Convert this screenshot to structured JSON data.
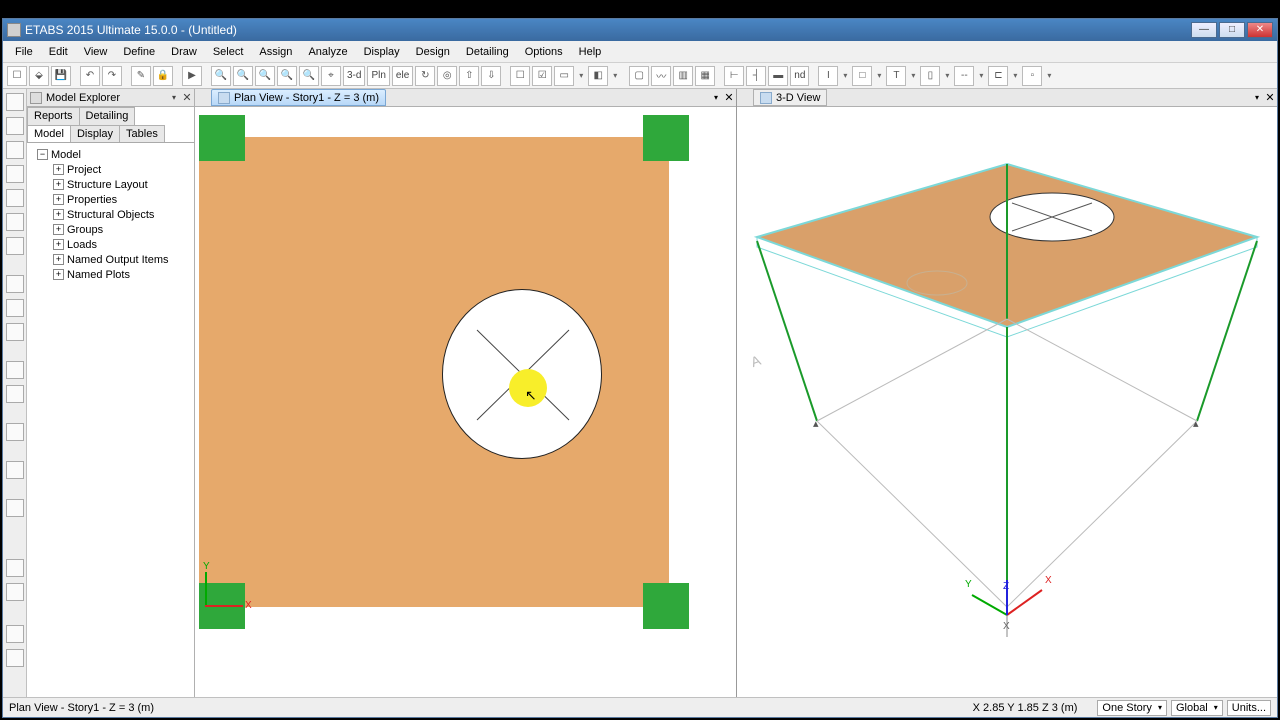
{
  "title": "ETABS 2015 Ultimate 15.0.0 - (Untitled)",
  "menus": [
    "File",
    "Edit",
    "View",
    "Define",
    "Draw",
    "Select",
    "Assign",
    "Analyze",
    "Display",
    "Design",
    "Detailing",
    "Options",
    "Help"
  ],
  "toolbar_text": {
    "threeD": "3-d",
    "pln": "Pln",
    "ele": "ele",
    "nd": "nd"
  },
  "explorer": {
    "title": "Model Explorer",
    "tabs1": [
      "Reports",
      "Detailing"
    ],
    "tabs2": [
      "Model",
      "Display",
      "Tables"
    ],
    "root": "Model",
    "children": [
      "Project",
      "Structure Layout",
      "Properties",
      "Structural Objects",
      "Groups",
      "Loads",
      "Named Output Items",
      "Named Plots"
    ]
  },
  "views": {
    "plan_label": "Plan View - Story1 - Z = 3 (m)",
    "threeD_label": "3-D View"
  },
  "plan_axes": {
    "x": "X",
    "y": "Y"
  },
  "threeD_axes": {
    "x": "X",
    "y": "Y",
    "z": "Z",
    "bottom": "X"
  },
  "status": {
    "left": "Plan View - Story1 - Z = 3 (m)",
    "coords": "X 2.85  Y 1.85  Z 3 (m)",
    "story": "One Story",
    "coordsys": "Global",
    "units": "Units..."
  }
}
